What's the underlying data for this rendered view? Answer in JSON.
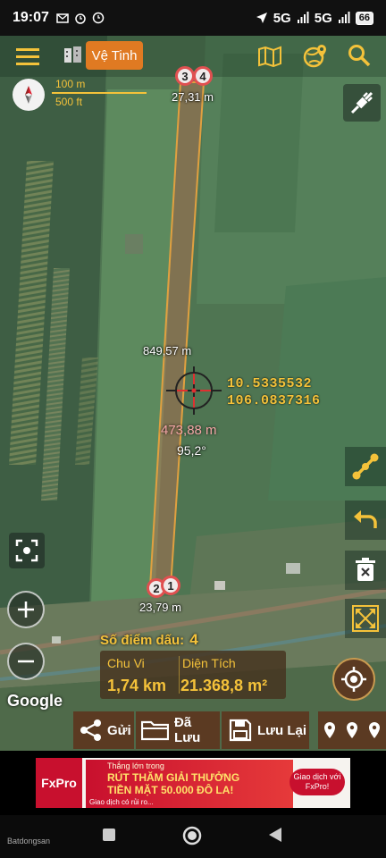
{
  "status": {
    "time": "19:07",
    "network1": "5G",
    "network2": "5G",
    "battery": "66"
  },
  "toolbar": {
    "map_type_label": "Vệ Tinh"
  },
  "scale": {
    "metric": "100 m",
    "imperial": "500 ft"
  },
  "map": {
    "top_markers": [
      "3",
      "4"
    ],
    "top_distance": "27,31 m",
    "center_label": "849,57 m",
    "bottom_markers": [
      "2",
      "1"
    ],
    "bottom_distance": "23,79 m",
    "center_distance": "473,88 m",
    "center_angle": "95,2°",
    "latitude": "10.5335532",
    "longitude": "106.0837316",
    "google_logo": "Google"
  },
  "stats": {
    "points_label": "Số điểm dấu:",
    "points_count": "4",
    "perimeter_label": "Chu Vi",
    "perimeter_value": "1,74 km",
    "area_label": "Diện Tích",
    "area_value": "21.368,8 m²"
  },
  "actions": {
    "send": "Gửi",
    "saved": "Đã Lưu",
    "save": "Lưu Lại"
  },
  "ad": {
    "brand": "FxPro",
    "line1": "Thắng lớn trong",
    "line2": "RÚT THĂM GIẢI THƯỞNG",
    "line3": "TIỀN MẶT 50.000 ĐÔ LA!",
    "disclaimer": "Giao dịch có rủi ro...",
    "cta": "Giao dịch với FxPro!"
  },
  "watermark": "Batdongsan"
}
